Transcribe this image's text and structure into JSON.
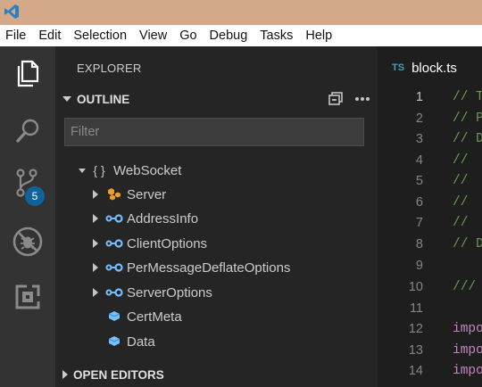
{
  "menubar": {
    "items": [
      "File",
      "Edit",
      "Selection",
      "View",
      "Go",
      "Debug",
      "Tasks",
      "Help"
    ]
  },
  "activity_bar": {
    "items": [
      "explorer-icon",
      "search-icon",
      "source-control-icon",
      "debug-icon",
      "extensions-icon"
    ],
    "scm_badge": "5",
    "badge_color": "#0e639c"
  },
  "sidebar": {
    "title": "EXPLORER",
    "outline": {
      "title": "OUTLINE",
      "filter_placeholder": "Filter",
      "root": {
        "label": "WebSocket",
        "icon": "namespace-icon",
        "expanded": true
      },
      "items": [
        {
          "label": "Server",
          "icon": "class-icon",
          "expandable": true
        },
        {
          "label": "AddressInfo",
          "icon": "interface-icon",
          "expandable": true
        },
        {
          "label": "ClientOptions",
          "icon": "interface-icon",
          "expandable": true
        },
        {
          "label": "PerMessageDeflateOptions",
          "icon": "interface-icon",
          "expandable": true
        },
        {
          "label": "ServerOptions",
          "icon": "interface-icon",
          "expandable": true
        },
        {
          "label": "CertMeta",
          "icon": "type-icon",
          "expandable": false
        },
        {
          "label": "Data",
          "icon": "type-icon",
          "expandable": false
        }
      ]
    },
    "open_editors": {
      "title": "OPEN EDITORS"
    }
  },
  "editor": {
    "tab": {
      "icon_label": "TS",
      "title": "block.ts"
    },
    "lines": [
      {
        "num": "1",
        "text": "// T",
        "kind": "comment",
        "active": true
      },
      {
        "num": "2",
        "text": "// P",
        "kind": "comment"
      },
      {
        "num": "3",
        "text": "// D",
        "kind": "comment"
      },
      {
        "num": "4",
        "text": "//",
        "kind": "comment"
      },
      {
        "num": "5",
        "text": "//",
        "kind": "comment"
      },
      {
        "num": "6",
        "text": "//",
        "kind": "comment"
      },
      {
        "num": "7",
        "text": "//",
        "kind": "comment"
      },
      {
        "num": "8",
        "text": "// D",
        "kind": "comment"
      },
      {
        "num": "9",
        "text": "",
        "kind": "comment"
      },
      {
        "num": "10",
        "text": "///",
        "kind": "comment"
      },
      {
        "num": "11",
        "text": "",
        "kind": "comment"
      },
      {
        "num": "12",
        "text": "impo",
        "kind": "keyword"
      },
      {
        "num": "13",
        "text": "impo",
        "kind": "keyword"
      },
      {
        "num": "14",
        "text": "impo",
        "kind": "keyword"
      }
    ]
  }
}
